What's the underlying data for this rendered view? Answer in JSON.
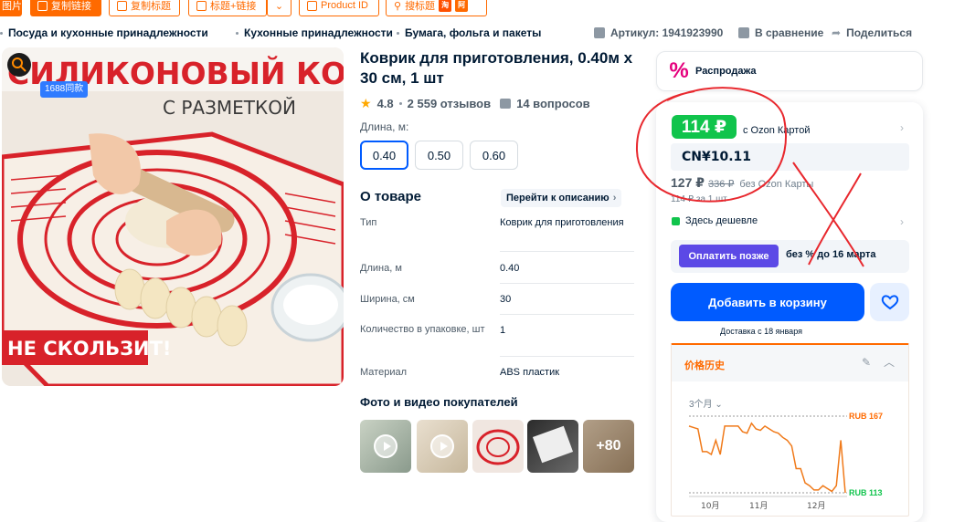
{
  "toolbar": {
    "image_btn": "图片",
    "copy_link": "复制链接",
    "copy_title": "复制标题",
    "title_link": "标题+链接",
    "product_id": "Product ID",
    "search_title": "搜标题"
  },
  "breadcrumbs": [
    "Посуда и кухонные принадлежности",
    "Кухонные принадлежности",
    "Бумага, фольга и пакеты"
  ],
  "meta": {
    "article": "Артикул: 1941923990",
    "compare": "В сравнение",
    "share": "Поделиться"
  },
  "photo": {
    "headline": "СИЛИКОНОВЫЙ КОВРИК",
    "subline": "С РАЗМЕТКОЙ",
    "badge": "1688同款",
    "nonslip": "НЕ СКОЛЬЗИТ!"
  },
  "product": {
    "title": "Коврик для приготовления, 0.40м х 30 см, 1 шт",
    "rating": "4.8",
    "reviews": "2 559 отзывов",
    "questions": "14 вопросов",
    "length_label": "Длина, м:",
    "sizes": [
      "0.40",
      "0.50",
      "0.60"
    ]
  },
  "about": {
    "heading": "О товаре",
    "link": "Перейти к описанию",
    "specs": [
      {
        "k": "Тип",
        "v": "Коврик для приготовления"
      },
      {
        "k": "Длина, м",
        "v": "0.40"
      },
      {
        "k": "Ширина, см",
        "v": "30"
      },
      {
        "k": "Количество в упаковке, шт",
        "v": "1"
      },
      {
        "k": "Материал",
        "v": "ABS пластик"
      }
    ]
  },
  "customer_photos": {
    "heading": "Фото и видео покупателей",
    "more": "+80"
  },
  "sale": {
    "label": "Распродажа"
  },
  "price": {
    "ozon_price": "114 ₽",
    "ozon_card": "с Ozon Картой",
    "cny": "CN¥10.11",
    "regular": "127 ₽",
    "old": "336 ₽",
    "without_card": "без Ozon Карты",
    "per_unit": "114 ₽ за 1 шт",
    "cheaper": "Здесь дешевле",
    "pay_later_btn": "Оплатить позже",
    "pay_later_text": "без % до 16 марта",
    "add_to_cart": "Добавить в корзину",
    "delivery": "Доставка с 18 января"
  },
  "price_history": {
    "title": "价格历史",
    "range": "3个月",
    "max_label": "RUB 167",
    "min_label": "RUB 113"
  },
  "chart_data": {
    "type": "line",
    "title": "价格历史",
    "x_tick_labels": [
      "10月",
      "11月",
      "12月"
    ],
    "ylim": [
      113,
      167
    ],
    "series": [
      {
        "values": [
          160,
          159,
          158,
          142,
          142,
          140,
          150,
          140,
          160,
          160,
          160,
          160,
          156,
          155,
          162,
          158,
          157,
          160,
          158,
          156,
          155,
          152,
          150,
          146,
          130,
          130,
          120,
          118,
          115,
          115,
          118,
          116,
          114,
          118,
          150,
          113
        ]
      }
    ],
    "annotations": [
      "RUB 167",
      "RUB 113"
    ],
    "colors": {
      "line": "#f07a1a",
      "ref": "#999999"
    }
  }
}
